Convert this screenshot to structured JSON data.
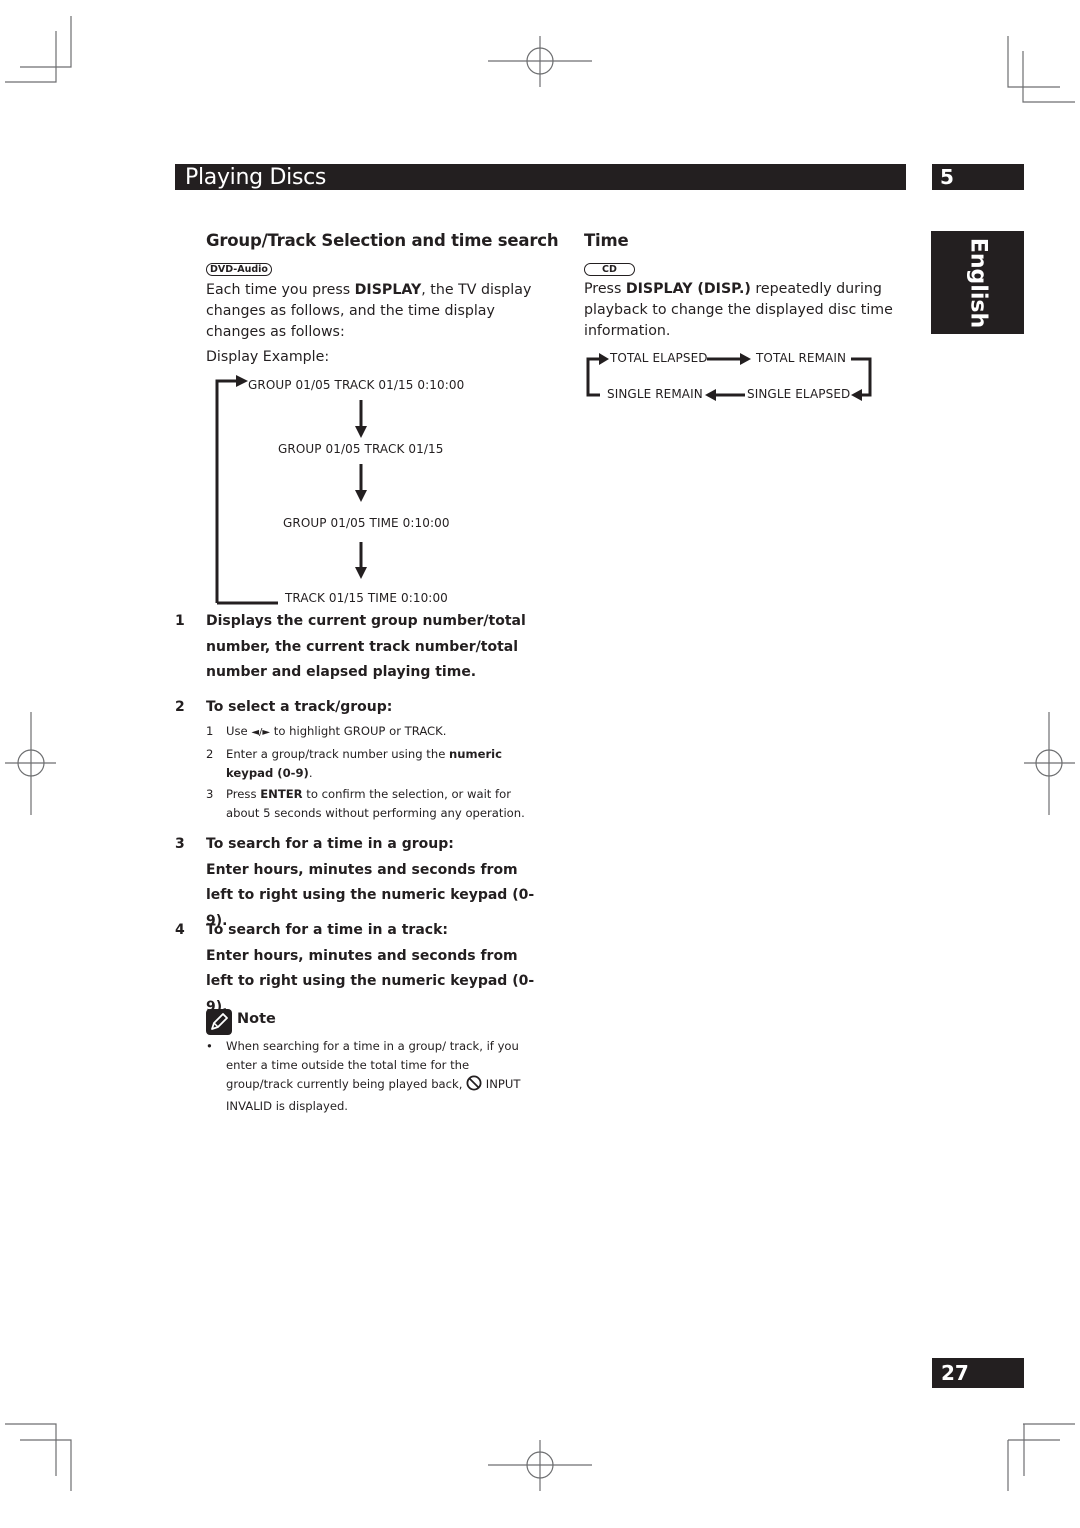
{
  "header": {
    "section_title": "Playing Discs",
    "chapter_number": "5",
    "language_tab": "English"
  },
  "left_column": {
    "heading": "Group/Track Selection and time search",
    "disc_badge": "DVD-Audio",
    "intro_parts": [
      "Each time you press ",
      "DISPLAY",
      ", the TV display changes as follows, and the time display changes as follows:"
    ],
    "display_example_label": "Display Example:",
    "display_sequence": [
      "GROUP 01/05 TRACK 01/15 0:10:00",
      "GROUP 01/05 TRACK 01/15",
      "GROUP 01/05 TIME 0:10:00",
      "TRACK 01/15 TIME 0:10:00"
    ],
    "steps": [
      {
        "number": "1",
        "text": "Displays the current group number/total number, the current track number/total number and elapsed playing time."
      },
      {
        "number": "2",
        "text": "To select a track/group:",
        "substeps": [
          {
            "number": "1",
            "parts": [
              "Use ",
              "◄/►",
              " to highlight GROUP or TRACK."
            ]
          },
          {
            "number": "2",
            "parts": [
              "Enter a group/track number using the ",
              "numeric keypad (0-9)",
              "."
            ]
          },
          {
            "number": "3",
            "parts": [
              "Press ",
              "ENTER",
              " to confirm the selection, or wait for about 5 seconds without performing any operation."
            ]
          }
        ]
      },
      {
        "number": "3",
        "title": "To search for a time in a group:",
        "text": "Enter hours, minutes and seconds from left to right using the numeric keypad (0-9)."
      },
      {
        "number": "4",
        "title": "To search for a time in a track:",
        "text": "Enter hours, minutes and seconds from left to right using the numeric keypad (0-9)."
      }
    ],
    "note": {
      "label": "Note",
      "bullet": "•",
      "text_before": "When searching for a time in a group/ track, if you enter a time outside the total time for the group/track currently being played back, ",
      "text_after": " INPUT INVALID is displayed."
    }
  },
  "right_column": {
    "heading": "Time",
    "disc_badge": "CD",
    "intro_parts": [
      "Press ",
      "DISPLAY (DISP.)",
      " repeatedly during playback to change the displayed disc time information."
    ],
    "cycle": {
      "total_elapsed": "TOTAL ELAPSED",
      "total_remain": "TOTAL REMAIN",
      "single_elapsed": "SINGLE ELAPSED",
      "single_remain": "SINGLE REMAIN"
    }
  },
  "footer": {
    "page_number": "27"
  }
}
